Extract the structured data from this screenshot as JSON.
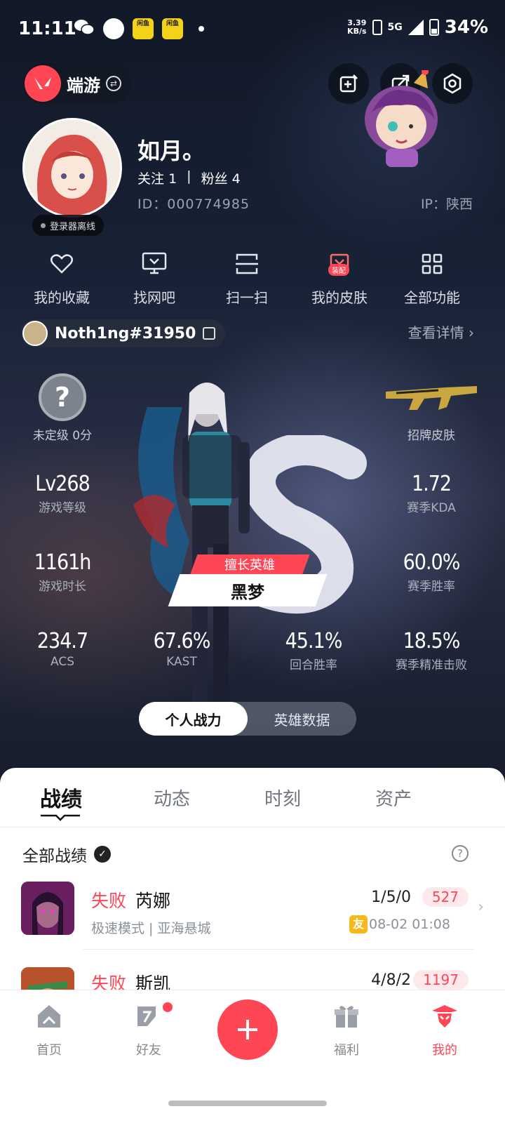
{
  "status_bar": {
    "time": "11:11",
    "net_speed_value": "3.39",
    "net_speed_unit": "KB/s",
    "network": "5G",
    "battery": "34%",
    "app_badge_text": "闲鱼"
  },
  "header": {
    "game_label": "端游",
    "buttons": [
      "edit-icon",
      "share-icon",
      "settings-icon"
    ]
  },
  "profile": {
    "nickname": "如月。",
    "follow_label": "关注",
    "follow_count": "1",
    "separator": "|",
    "fans_label": "粉丝",
    "fans_count": "4",
    "id_text": "ID：000774985",
    "ip_text": "IP：陕西",
    "status": "登录器离线"
  },
  "quick_actions": [
    {
      "label": "我的收藏",
      "icon": "heart-icon"
    },
    {
      "label": "找网吧",
      "icon": "monitor-icon"
    },
    {
      "label": "扫一扫",
      "icon": "scan-icon"
    },
    {
      "label": "我的皮肤",
      "icon": "skin-icon",
      "badge": "装配"
    },
    {
      "label": "全部功能",
      "icon": "grid-icon"
    }
  ],
  "riot": {
    "name": "Noth1ng#31950",
    "view_detail": "查看详情 ›"
  },
  "stats": {
    "rank_symbol": "?",
    "rank_label": "未定级 0分",
    "skin_label": "招牌皮肤",
    "level_value": "Lv268",
    "level_label": "游戏等级",
    "kda_value": "1.72",
    "kda_label": "赛季KDA",
    "hours_value": "1161h",
    "hours_label": "游戏时长",
    "winrate_value": "60.0%",
    "winrate_label": "赛季胜率",
    "acs_value": "234.7",
    "acs_label": "ACS",
    "kast_value": "67.6%",
    "kast_label": "KAST",
    "round_value": "45.1%",
    "round_label": "回合胜率",
    "hs_value": "18.5%",
    "hs_label": "赛季精准击败"
  },
  "hero": {
    "tag": "擅长英雄",
    "name": "黑梦"
  },
  "segment": [
    "个人战力",
    "英雄数据"
  ],
  "tabs": [
    "战绩",
    "动态",
    "时刻",
    "资产"
  ],
  "filter": {
    "label": "全部战绩",
    "help": "?"
  },
  "matches": [
    {
      "result": "失败",
      "agent": "芮娜",
      "mode": "极速模式 | 亚海悬城",
      "kda": "1/5/0",
      "score": "527",
      "friend": "友",
      "time": "08-02 01:08",
      "color": "#7a2e6a"
    },
    {
      "result": "失败",
      "agent": "斯凯",
      "kda": "4/8/2",
      "score": "1197",
      "color": "#c2572a"
    }
  ],
  "nav": [
    {
      "label": "首页",
      "icon": "home-icon"
    },
    {
      "label": "好友",
      "icon": "friends-icon"
    },
    {
      "label": "福利",
      "icon": "gift-icon"
    },
    {
      "label": "我的",
      "icon": "profile-icon"
    }
  ],
  "colors": {
    "accent": "#ff4655",
    "score_bg": "#fde9eb",
    "friend_badge": "#f6b81a"
  }
}
